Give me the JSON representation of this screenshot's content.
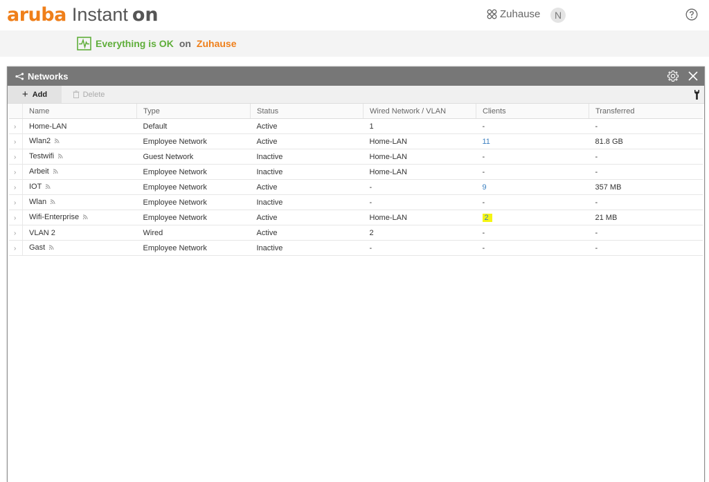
{
  "app": {
    "brand_aruba": "aruba",
    "brand_instant": "Instant",
    "brand_on": "on",
    "site_name": "Zuhause",
    "avatar_initial": "N"
  },
  "status": {
    "message": "Everything is OK",
    "connector": "on",
    "site": "Zuhause"
  },
  "panel": {
    "title": "Networks",
    "add_label": "Add",
    "delete_label": "Delete"
  },
  "table": {
    "headers": [
      "Name",
      "Type",
      "Status",
      "Wired Network / VLAN",
      "Clients",
      "Transferred"
    ],
    "rows": [
      {
        "name": "Home-LAN",
        "wifi": false,
        "type": "Default",
        "status": "Active",
        "wired": "1",
        "clients": "-",
        "clients_link": false,
        "highlight": false,
        "transferred": "-"
      },
      {
        "name": "Wlan2",
        "wifi": true,
        "type": "Employee Network",
        "status": "Active",
        "wired": "Home-LAN",
        "clients": "11",
        "clients_link": true,
        "highlight": false,
        "transferred": "81.8 GB"
      },
      {
        "name": "Testwifi",
        "wifi": true,
        "type": "Guest Network",
        "status": "Inactive",
        "wired": "Home-LAN",
        "clients": "-",
        "clients_link": false,
        "highlight": false,
        "transferred": "-"
      },
      {
        "name": "Arbeit",
        "wifi": true,
        "type": "Employee Network",
        "status": "Inactive",
        "wired": "Home-LAN",
        "clients": "-",
        "clients_link": false,
        "highlight": false,
        "transferred": "-"
      },
      {
        "name": "IOT",
        "wifi": true,
        "type": "Employee Network",
        "status": "Active",
        "wired": "-",
        "clients": "9",
        "clients_link": true,
        "highlight": false,
        "transferred": "357 MB"
      },
      {
        "name": "Wlan",
        "wifi": true,
        "type": "Employee Network",
        "status": "Inactive",
        "wired": "-",
        "clients": "-",
        "clients_link": false,
        "highlight": false,
        "transferred": "-"
      },
      {
        "name": "Wifi-Enterprise",
        "wifi": true,
        "type": "Employee Network",
        "status": "Active",
        "wired": "Home-LAN",
        "clients": "2",
        "clients_link": true,
        "highlight": true,
        "transferred": "21 MB"
      },
      {
        "name": "VLAN 2",
        "wifi": false,
        "type": "Wired",
        "status": "Active",
        "wired": "2",
        "clients": "-",
        "clients_link": false,
        "highlight": false,
        "transferred": "-"
      },
      {
        "name": "Gast",
        "wifi": true,
        "type": "Employee Network",
        "status": "Inactive",
        "wired": "-",
        "clients": "-",
        "clients_link": false,
        "highlight": false,
        "transferred": "-"
      }
    ]
  },
  "colors": {
    "brand_orange": "#ef7f1a",
    "ok_green": "#5fae3a",
    "panel_header": "#777777",
    "link_blue": "#3a7fc0",
    "highlight_yellow": "#f5f514"
  },
  "icons": {
    "site": "sites-grid-icon",
    "help": "help-circle-icon",
    "health": "heartbeat-monitor-icon",
    "networks": "network-share-icon",
    "settings": "gear-icon",
    "close": "close-icon",
    "add": "plus-icon",
    "delete": "trash-icon",
    "tools": "wrench-icon",
    "expand": "chevron-right-icon",
    "wifi": "wifi-signal-icon"
  }
}
